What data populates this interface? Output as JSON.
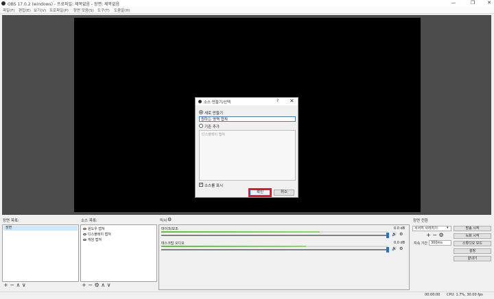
{
  "window": {
    "title": "OBS 17.0.2 (windows) - 프로파일: 제목없음 - 장면: 제목없음",
    "minimize": "—",
    "maximize": "❐",
    "close": "✕"
  },
  "menu": [
    "파일(F)",
    "편집(E)",
    "보기(V)",
    "프로파일(P)",
    "장면 모음(S)",
    "도구(T)",
    "도움말(H)"
  ],
  "dialog": {
    "title": "소스 만들기/선택",
    "help": "?",
    "close": "✕",
    "create_new_label": "새로 만들기",
    "name_value": "원하는 영역 캡쳐",
    "add_existing_label": "기존 추가",
    "existing_items": [
      "디스플레이 캡쳐"
    ],
    "visible_checkbox_label": "소스를 표시",
    "visible_checked": true,
    "ok_label": "확인",
    "cancel_label": "취소"
  },
  "scenes": {
    "title": "장면 목록:",
    "items": [
      "장면"
    ],
    "toolbar": "+ − ∧ ∨"
  },
  "sources": {
    "title": "소스 목록:",
    "items": [
      "윈도우 캡쳐",
      "디스플레이 캡쳐",
      "게임 캡쳐"
    ],
    "toolbar": "+ − ⚙ ∧ ∨"
  },
  "mixer": {
    "title": "믹서",
    "tracks": [
      {
        "name": "마이크/보조",
        "db": "0.0 dB",
        "level": 0.7
      },
      {
        "name": "데스크탑 오디오",
        "db": "0.0 dB",
        "level": 0.64
      }
    ]
  },
  "transitions": {
    "title": "장면 전환",
    "selected": "서서히 사라지기",
    "toolbar": "+ − ⚙",
    "duration_label": "지속 기간",
    "duration_value": "300ms"
  },
  "controls": [
    "방송 시작",
    "녹화 시작",
    "스튜디오 모드",
    "설정",
    "끝내기"
  ],
  "status": {
    "time": "00:00:00",
    "cpu": "CPU: 1.7%, 30.00 fps"
  },
  "colors": {
    "accent": "#0078d7",
    "highlight_box": "#e81123",
    "meter": "#5bbf3a",
    "preview_bg": "#4c4c4c"
  }
}
